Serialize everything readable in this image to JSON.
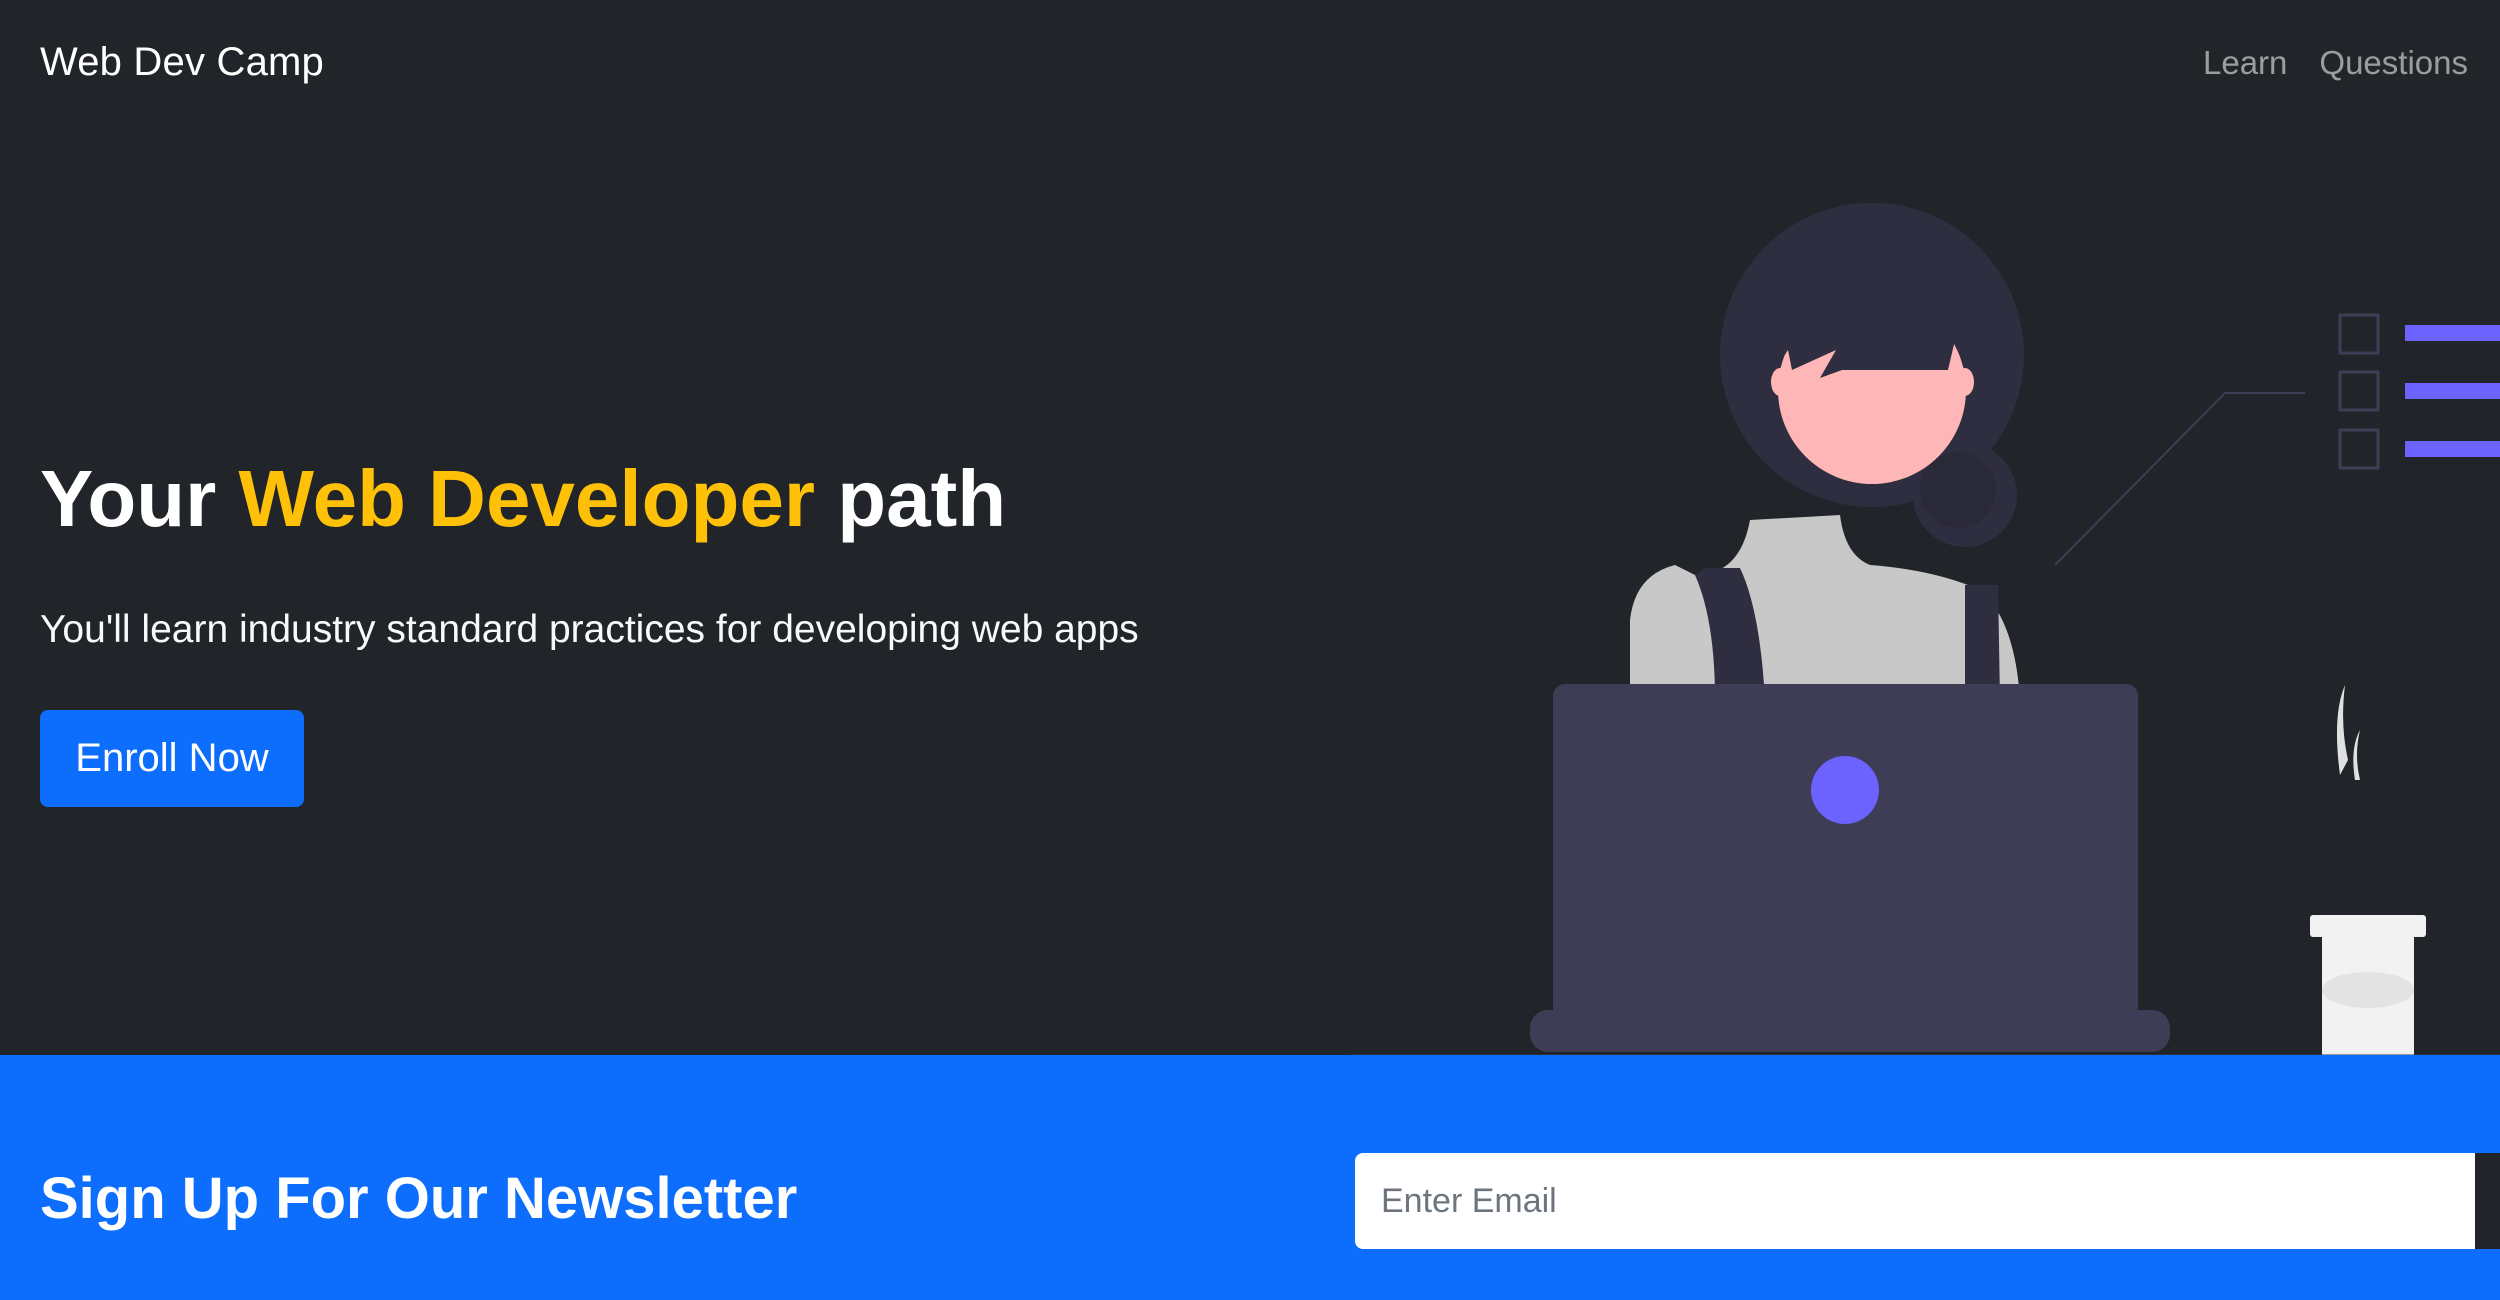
{
  "navbar": {
    "brand": "Web Dev Camp",
    "links": [
      {
        "label": "Learn"
      },
      {
        "label": "Questions"
      }
    ]
  },
  "hero": {
    "title_part1": "Your ",
    "title_highlight": "Web Developer",
    "title_part2": " path",
    "subtitle": "You'll learn industry standard practices for developing web apps",
    "button_label": "Enroll Now"
  },
  "newsletter": {
    "title": "Sign Up For Our Newsletter",
    "email_placeholder": "Enter Email",
    "email_value": ""
  },
  "colors": {
    "background": "#212529",
    "primary": "#0d6efd",
    "highlight": "#ffc107",
    "accent": "#6c63ff"
  },
  "icons": {
    "illustration": "person-at-laptop-illustration"
  }
}
